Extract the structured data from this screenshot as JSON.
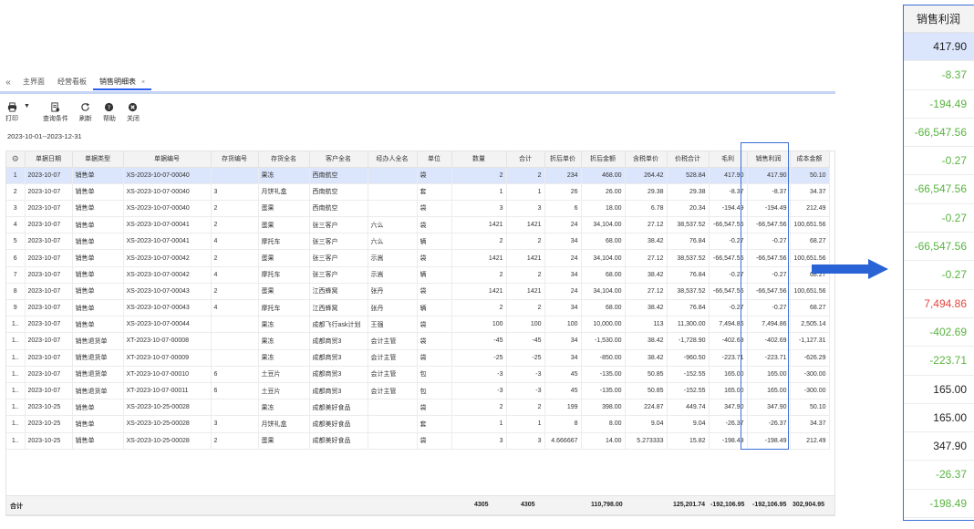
{
  "tabs": {
    "collapse": "«",
    "items": [
      "主界面",
      "经营看板",
      "销售明细表"
    ],
    "close": "×"
  },
  "toolbar": {
    "print": "打印",
    "caret": "▼",
    "query": "查询条件",
    "refresh": "刷新",
    "help": "帮助",
    "close": "关闭"
  },
  "date_range": "2023-10-01--2023-12-31",
  "table": {
    "gear": "⚙",
    "headers": [
      "单据日期",
      "单据类型",
      "单据编号",
      "存货编号",
      "存货全名",
      "客户全名",
      "经办人全名",
      "单位",
      "数量",
      "合计",
      "折后单价",
      "折后金额",
      "含税单价",
      "价税合计",
      "毛利",
      "销售利润",
      "成本金额"
    ],
    "rows": [
      {
        "no": "1",
        "date": "2023-10-07",
        "type": "销售单",
        "code": "XS-2023-10-07-00040",
        "item_no": "",
        "item": "果冻",
        "customer": "西南航空",
        "handler": "",
        "unit": "袋",
        "qty": "2",
        "total": "2",
        "price": "234",
        "amount": "468.00",
        "tax_price": "264.42",
        "tax_total": "528.84",
        "gross": "417.90",
        "profit": "417.90",
        "cost": "50.10",
        "profit_color": "plain"
      },
      {
        "no": "2",
        "date": "2023-10-07",
        "type": "销售单",
        "code": "XS-2023-10-07-00040",
        "item_no": "3",
        "item": "月饼礼盒",
        "customer": "西南航空",
        "handler": "",
        "unit": "套",
        "qty": "1",
        "total": "1",
        "price": "26",
        "amount": "26.00",
        "tax_price": "29.38",
        "tax_total": "29.38",
        "gross": "-8.37",
        "profit": "-8.37",
        "cost": "34.37",
        "profit_color": "neg"
      },
      {
        "no": "3",
        "date": "2023-10-07",
        "type": "销售单",
        "code": "XS-2023-10-07-00040",
        "item_no": "2",
        "item": "蛋果",
        "customer": "西南航空",
        "handler": "",
        "unit": "袋",
        "qty": "3",
        "total": "3",
        "price": "6",
        "amount": "18.00",
        "tax_price": "6.78",
        "tax_total": "20.34",
        "gross": "-194.49",
        "profit": "-194.49",
        "cost": "212.49",
        "profit_color": "neg"
      },
      {
        "no": "4",
        "date": "2023-10-07",
        "type": "销售单",
        "code": "XS-2023-10-07-00041",
        "item_no": "2",
        "item": "蛋果",
        "customer": "张三客户",
        "handler": "六么",
        "unit": "袋",
        "qty": "1421",
        "total": "1421",
        "price": "24",
        "amount": "34,104.00",
        "tax_price": "27.12",
        "tax_total": "38,537.52",
        "gross": "-66,547.56",
        "profit": "-66,547.56",
        "cost": "100,651.56",
        "profit_color": "neg"
      },
      {
        "no": "5",
        "date": "2023-10-07",
        "type": "销售单",
        "code": "XS-2023-10-07-00041",
        "item_no": "4",
        "item": "摩托车",
        "customer": "张三客户",
        "handler": "六么",
        "unit": "辆",
        "qty": "2",
        "total": "2",
        "price": "34",
        "amount": "68.00",
        "tax_price": "38.42",
        "tax_total": "76.84",
        "gross": "-0.27",
        "profit": "-0.27",
        "cost": "68.27",
        "profit_color": "neg"
      },
      {
        "no": "6",
        "date": "2023-10-07",
        "type": "销售单",
        "code": "XS-2023-10-07-00042",
        "item_no": "2",
        "item": "蛋果",
        "customer": "张三客户",
        "handler": "示嵩",
        "unit": "袋",
        "qty": "1421",
        "total": "1421",
        "price": "24",
        "amount": "34,104.00",
        "tax_price": "27.12",
        "tax_total": "38,537.52",
        "gross": "-66,547.56",
        "profit": "-66,547.56",
        "cost": "100,651.56",
        "profit_color": "neg"
      },
      {
        "no": "7",
        "date": "2023-10-07",
        "type": "销售单",
        "code": "XS-2023-10-07-00042",
        "item_no": "4",
        "item": "摩托车",
        "customer": "张三客户",
        "handler": "示嵩",
        "unit": "辆",
        "qty": "2",
        "total": "2",
        "price": "34",
        "amount": "68.00",
        "tax_price": "38.42",
        "tax_total": "76.84",
        "gross": "-0.27",
        "profit": "-0.27",
        "cost": "68.27",
        "profit_color": "neg"
      },
      {
        "no": "8",
        "date": "2023-10-07",
        "type": "销售单",
        "code": "XS-2023-10-07-00043",
        "item_no": "2",
        "item": "蛋果",
        "customer": "江西蜂窝",
        "handler": "张丹",
        "unit": "袋",
        "qty": "1421",
        "total": "1421",
        "price": "24",
        "amount": "34,104.00",
        "tax_price": "27.12",
        "tax_total": "38,537.52",
        "gross": "-66,547.56",
        "profit": "-66,547.56",
        "cost": "100,651.56",
        "profit_color": "neg"
      },
      {
        "no": "9",
        "date": "2023-10-07",
        "type": "销售单",
        "code": "XS-2023-10-07-00043",
        "item_no": "4",
        "item": "摩托车",
        "customer": "江西蜂窝",
        "handler": "张丹",
        "unit": "辆",
        "qty": "2",
        "total": "2",
        "price": "34",
        "amount": "68.00",
        "tax_price": "38.42",
        "tax_total": "76.84",
        "gross": "-0.27",
        "profit": "-0.27",
        "cost": "68.27",
        "profit_color": "neg"
      },
      {
        "no": "1..",
        "date": "2023-10-07",
        "type": "销售单",
        "code": "XS-2023-10-07-00044",
        "item_no": "",
        "item": "果冻",
        "customer": "成都飞行ask计划",
        "handler": "王强",
        "unit": "袋",
        "qty": "100",
        "total": "100",
        "price": "100",
        "amount": "10,000.00",
        "tax_price": "113",
        "tax_total": "11,300.00",
        "gross": "7,494.86",
        "profit": "7,494.86",
        "cost": "2,505.14",
        "profit_color": "pos"
      },
      {
        "no": "1..",
        "date": "2023-10-07",
        "type": "销售退货单",
        "code": "XT-2023-10-07-00008",
        "item_no": "",
        "item": "果冻",
        "customer": "成都商贸3",
        "handler": "会计主管",
        "unit": "袋",
        "qty": "-45",
        "total": "-45",
        "price": "34",
        "amount": "-1,530.00",
        "tax_price": "38.42",
        "tax_total": "-1,728.90",
        "gross": "-402.69",
        "profit": "-402.69",
        "cost": "-1,127.31",
        "profit_color": "neg"
      },
      {
        "no": "1..",
        "date": "2023-10-07",
        "type": "销售退货单",
        "code": "XT-2023-10-07-00009",
        "item_no": "",
        "item": "果冻",
        "customer": "成都商贸3",
        "handler": "会计主管",
        "unit": "袋",
        "qty": "-25",
        "total": "-25",
        "price": "34",
        "amount": "-850.00",
        "tax_price": "38.42",
        "tax_total": "-960.50",
        "gross": "-223.71",
        "profit": "-223.71",
        "cost": "-626.29",
        "profit_color": "neg"
      },
      {
        "no": "1..",
        "date": "2023-10-07",
        "type": "销售退货单",
        "code": "XT-2023-10-07-00010",
        "item_no": "6",
        "item": "土豆片",
        "customer": "成都商贸3",
        "handler": "会计主管",
        "unit": "包",
        "qty": "-3",
        "total": "-3",
        "price": "45",
        "amount": "-135.00",
        "tax_price": "50.85",
        "tax_total": "-152.55",
        "gross": "165.00",
        "profit": "165.00",
        "cost": "-300.00",
        "profit_color": "plain"
      },
      {
        "no": "1..",
        "date": "2023-10-07",
        "type": "销售退货单",
        "code": "XT-2023-10-07-00011",
        "item_no": "6",
        "item": "土豆片",
        "customer": "成都商贸3",
        "handler": "会计主管",
        "unit": "包",
        "qty": "-3",
        "total": "-3",
        "price": "45",
        "amount": "-135.00",
        "tax_price": "50.85",
        "tax_total": "-152.55",
        "gross": "165.00",
        "profit": "165.00",
        "cost": "-300.00",
        "profit_color": "plain"
      },
      {
        "no": "1..",
        "date": "2023-10-25",
        "type": "销售单",
        "code": "XS-2023-10-25-00028",
        "item_no": "",
        "item": "果冻",
        "customer": "成都美好食品",
        "handler": "",
        "unit": "袋",
        "qty": "2",
        "total": "2",
        "price": "199",
        "amount": "398.00",
        "tax_price": "224.87",
        "tax_total": "449.74",
        "gross": "347.90",
        "profit": "347.90",
        "cost": "50.10",
        "profit_color": "plain"
      },
      {
        "no": "1..",
        "date": "2023-10-25",
        "type": "销售单",
        "code": "XS-2023-10-25-00028",
        "item_no": "3",
        "item": "月饼礼盒",
        "customer": "成都美好食品",
        "handler": "",
        "unit": "套",
        "qty": "1",
        "total": "1",
        "price": "8",
        "amount": "8.00",
        "tax_price": "9.04",
        "tax_total": "9.04",
        "gross": "-26.37",
        "profit": "-26.37",
        "cost": "34.37",
        "profit_color": "neg"
      },
      {
        "no": "1..",
        "date": "2023-10-25",
        "type": "销售单",
        "code": "XS-2023-10-25-00028",
        "item_no": "2",
        "item": "蛋果",
        "customer": "成都美好食品",
        "handler": "",
        "unit": "袋",
        "qty": "3",
        "total": "3",
        "price": "4.666667",
        "amount": "14.00",
        "tax_price": "5.273333",
        "tax_total": "15.82",
        "gross": "-198.49",
        "profit": "-198.49",
        "cost": "212.49",
        "profit_color": "neg"
      }
    ],
    "totals": {
      "label": "合计",
      "qty": "4305",
      "total": "4305",
      "amount": "110,798.00",
      "tax_total": "125,201.74",
      "gross": "-192,106.95",
      "profit": "-192,106.95",
      "cost": "302,904.95"
    }
  },
  "zoom": {
    "header": "销售利润",
    "values": [
      "417.90",
      "-8.37",
      "-194.49",
      "-66,547.56",
      "-0.27",
      "-66,547.56",
      "-0.27",
      "-66,547.56",
      "-0.27",
      "7,494.86",
      "-402.69",
      "-223.71",
      "165.00",
      "165.00",
      "347.90",
      "-26.37",
      "-198.49"
    ],
    "colors": [
      "plain",
      "neg",
      "neg",
      "neg",
      "neg",
      "neg",
      "neg",
      "neg",
      "neg",
      "pos",
      "neg",
      "neg",
      "plain",
      "plain",
      "plain",
      "neg",
      "neg"
    ]
  },
  "colors": {
    "accent": "#2d5ff0",
    "selected_row": "#dbe5fb",
    "profit_positive": "#e0463f",
    "profit_negative": "#59b340",
    "link": "#2b4fce"
  }
}
